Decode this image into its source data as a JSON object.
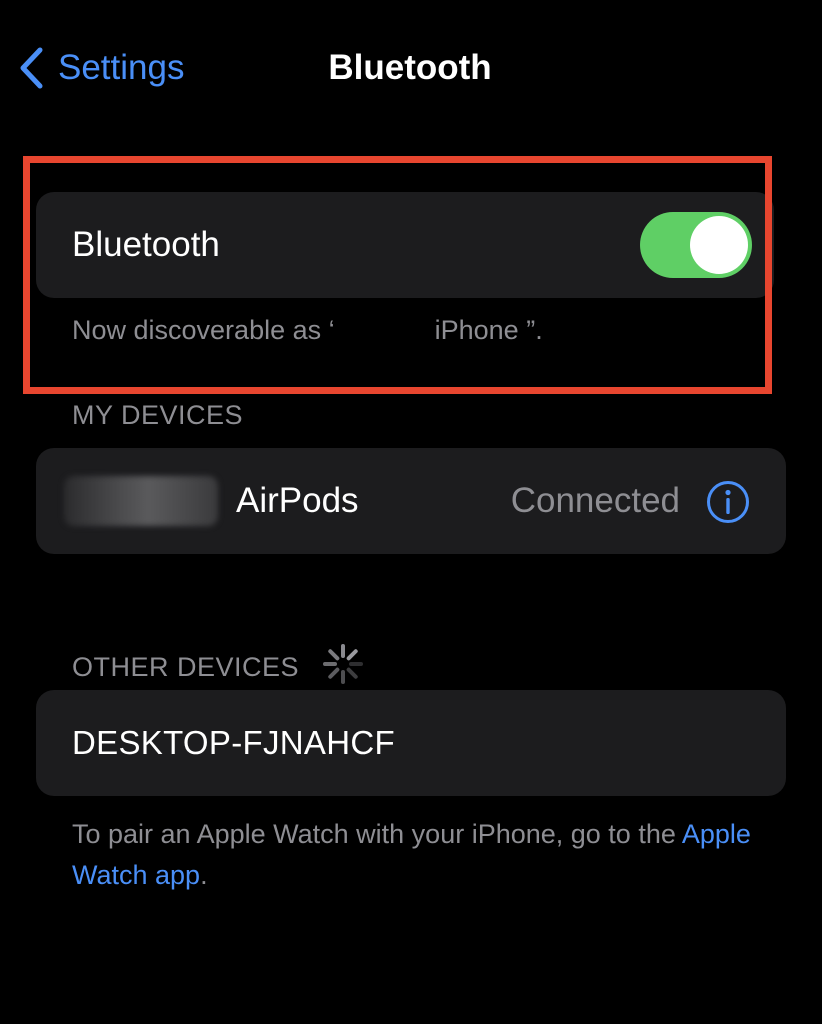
{
  "nav": {
    "back_label": "Settings",
    "title": "Bluetooth"
  },
  "bluetooth": {
    "label": "Bluetooth",
    "enabled": true,
    "discoverable_prefix": "Now discoverable as ‘",
    "discoverable_suffix": "iPhone ”."
  },
  "my_devices": {
    "header": "MY DEVICES",
    "items": [
      {
        "name": "AirPods",
        "status": "Connected"
      }
    ]
  },
  "other_devices": {
    "header": "OTHER DEVICES",
    "items": [
      {
        "name": "DESKTOP-FJNAHCF"
      }
    ]
  },
  "pair_note": {
    "text": "To pair an Apple Watch with your iPhone, go to the ",
    "link": "Apple Watch app",
    "end": "."
  },
  "colors": {
    "accent_blue": "#4a8ff7",
    "toggle_green": "#5fcf65",
    "highlight_red": "#e8462f",
    "card_bg": "#1c1c1e",
    "secondary_text": "#8e8e93"
  },
  "icons": {
    "back": "chevron-left-icon",
    "info": "info-circle-icon",
    "spinner": "activity-spinner-icon"
  }
}
